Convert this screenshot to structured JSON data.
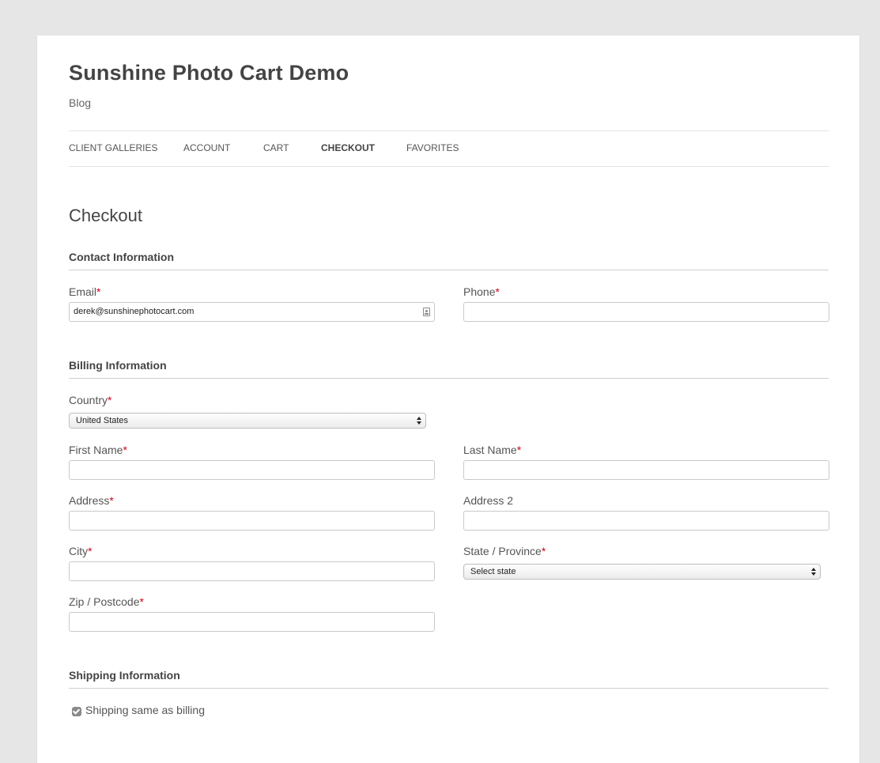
{
  "site": {
    "title": "Sunshine Photo Cart Demo",
    "description": "Blog"
  },
  "nav": {
    "items": [
      {
        "label": "CLIENT GALLERIES"
      },
      {
        "label": "ACCOUNT"
      },
      {
        "label": "CART"
      },
      {
        "label": "CHECKOUT",
        "active": true
      },
      {
        "label": "FAVORITES"
      }
    ]
  },
  "page": {
    "heading": "Checkout"
  },
  "contact": {
    "section_title": "Contact Information",
    "email_label": "Email",
    "email_value": "derek@sunshinephotocart.com",
    "phone_label": "Phone",
    "phone_value": ""
  },
  "billing": {
    "section_title": "Billing Information",
    "country_label": "Country",
    "country_value": "United States",
    "first_name_label": "First Name",
    "last_name_label": "Last Name",
    "address_label": "Address",
    "address2_label": "Address 2",
    "city_label": "City",
    "state_label": "State / Province",
    "state_value": "Select state",
    "zip_label": "Zip / Postcode"
  },
  "shipping": {
    "section_title": "Shipping Information",
    "same_as_billing_label": "Shipping same as billing",
    "same_as_billing_checked": true
  },
  "required_marker": "*",
  "colors": {
    "required": "#d0021b",
    "background": "#e6e6e6",
    "panel": "#ffffff"
  }
}
